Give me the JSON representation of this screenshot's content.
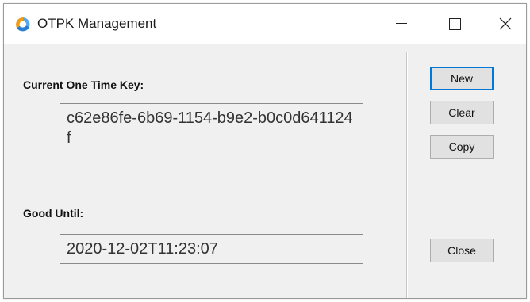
{
  "window": {
    "title": "OTPK Management",
    "icon": "app-logo-icon",
    "controls": {
      "minimize_icon": "minimize-icon",
      "maximize_icon": "maximize-icon",
      "close_icon": "close-icon"
    }
  },
  "form": {
    "key_label": "Current One Time Key:",
    "key_value": "c62e86fe-6b69-1154-b9e2-b0c0d641124f",
    "until_label": "Good Until:",
    "until_value": "2020-12-02T11:23:07"
  },
  "buttons": {
    "new_label": "New",
    "clear_label": "Clear",
    "copy_label": "Copy",
    "close_label": "Close"
  },
  "colors": {
    "focus_border": "#0078d7",
    "window_background": "#f0f0f0",
    "titlebar_background": "#ffffff",
    "icon_orange": "#f39c12",
    "icon_blue": "#2a7fd4"
  }
}
